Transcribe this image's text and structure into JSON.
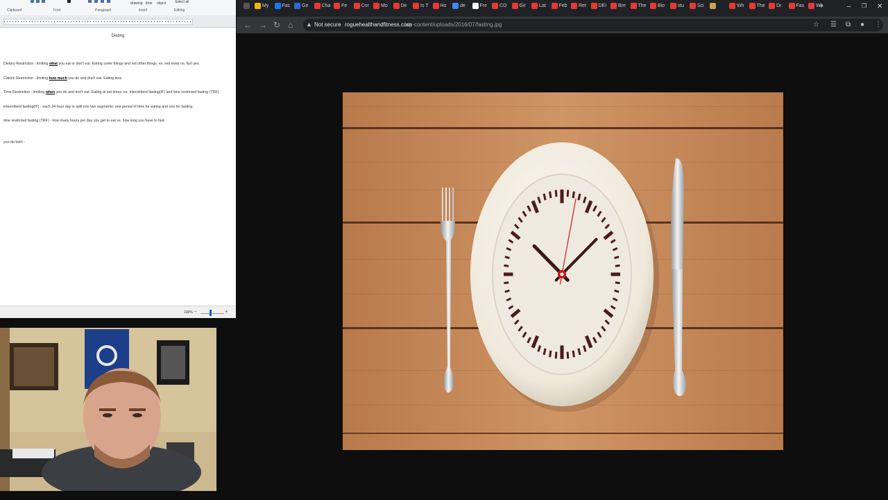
{
  "wordpad": {
    "ribbon": {
      "groups": [
        "Clipboard",
        "Font",
        "Paragraph",
        "Insert",
        "Editing"
      ],
      "buttons": [
        "drawing",
        "time",
        "object",
        "Select all"
      ]
    },
    "document": {
      "title": "Dieting",
      "lines": [
        {
          "before": "Dietary Restriction - limiting ",
          "bold": "what",
          "after": " you eat or don't eat.  Eating some things and not other things. ex. red meat no, fish yes."
        },
        {
          "before": "Caloric Restriction - limiting ",
          "bold": "how much",
          "after": " you do and don't eat.  Eating less."
        },
        {
          "before": "Time Restriction - limiting ",
          "bold": "when",
          "after": " you do and don't eat. Eating at set times.  ex. intermittent fasting(IF) and time restricted fasting (TRF)"
        },
        {
          "before": "intermittent fasting(IF) - each 24-hour day is split into two segments: one period of time for eating and one for fasting.",
          "bold": "",
          "after": ""
        },
        {
          "before": "time restricted fasting (TRF) - how many hours per day you get to eat vs. how long you have to fast.",
          "bold": "",
          "after": ""
        },
        {
          "before": "you do both -",
          "bold": "",
          "after": ""
        }
      ]
    },
    "status": {
      "zoom": "100%"
    }
  },
  "browser": {
    "tabs": [
      "My",
      "Fac",
      "Ge",
      "Cha",
      "Fe",
      "Cor",
      "Mo",
      "De",
      "Is T",
      "Ho",
      "de",
      "Fre",
      "CO",
      "Gir",
      "Lat",
      "Feb",
      "Ret",
      "DEI",
      "Bre",
      "The",
      "Bio",
      "stu",
      "Sci",
      "",
      "Wh",
      "The",
      "Dr.",
      "Fas",
      "Wh"
    ],
    "tab_colors": [
      "#f4b400",
      "#1877f2",
      "#3367d6",
      "#e53935",
      "#e53935",
      "#e53935",
      "#e53935",
      "#e53935",
      "#e53935",
      "#e53935",
      "#4285f4",
      "#ffffff",
      "#e53935",
      "#e53935",
      "#e53935",
      "#e53935",
      "#e53935",
      "#e53935",
      "#e53935",
      "#e53935",
      "#e53935",
      "#e53935",
      "#e53935",
      "#c8a060",
      "#e53935",
      "#e53935",
      "#e53935",
      "#e53935",
      "#e53935"
    ],
    "address": {
      "security_label": "Not secure",
      "host": "roguehealthandfitness.com",
      "path": "/wp-content/uploads/2016/07/fasting.jpg"
    },
    "image": {
      "icon": "plate-clock-fasting-image",
      "colors": {
        "wood": "#c98a5a",
        "plate": "#f4f1e8",
        "clock_marks": "#4a1c1c"
      },
      "clock": {
        "hour_hand_deg": -55,
        "minute_hand_deg": 55,
        "second_hand_deg": 15
      }
    }
  }
}
